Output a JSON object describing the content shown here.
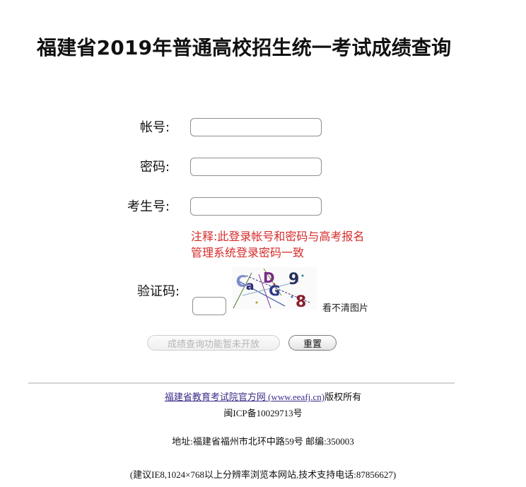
{
  "header": {
    "title": "福建省2019年普通高校招生统一考试成绩查询"
  },
  "form": {
    "account_label": "帐号:",
    "password_label": "密码:",
    "exam_number_label": "考生号:",
    "account_value": "",
    "password_value": "",
    "exam_number_value": "",
    "note_line1": "注释:此登录帐号和密码与高考报名",
    "note_line2": "管理系统登录密码一致",
    "captcha_label": "验证码:",
    "captcha_value": "",
    "captcha_chars": [
      "C",
      "a",
      "D",
      "G",
      "9",
      "8"
    ],
    "captcha_refresh": "看不清图片",
    "query_button": "成绩查询功能暂未开放",
    "reset_button": "重置",
    "note_color": "#d62b2b"
  },
  "footer": {
    "site_link": "福建省教育考试院官方网 (www.eeafj.cn)",
    "copyright": "版权所有",
    "icp": "闽ICP备10029713号",
    "address": "地址:福建省福州市北环中路59号 邮编:350003",
    "advice": "(建议IE8,1024×768以上分辨率浏览本网站,技术支持电话:87856627)"
  }
}
